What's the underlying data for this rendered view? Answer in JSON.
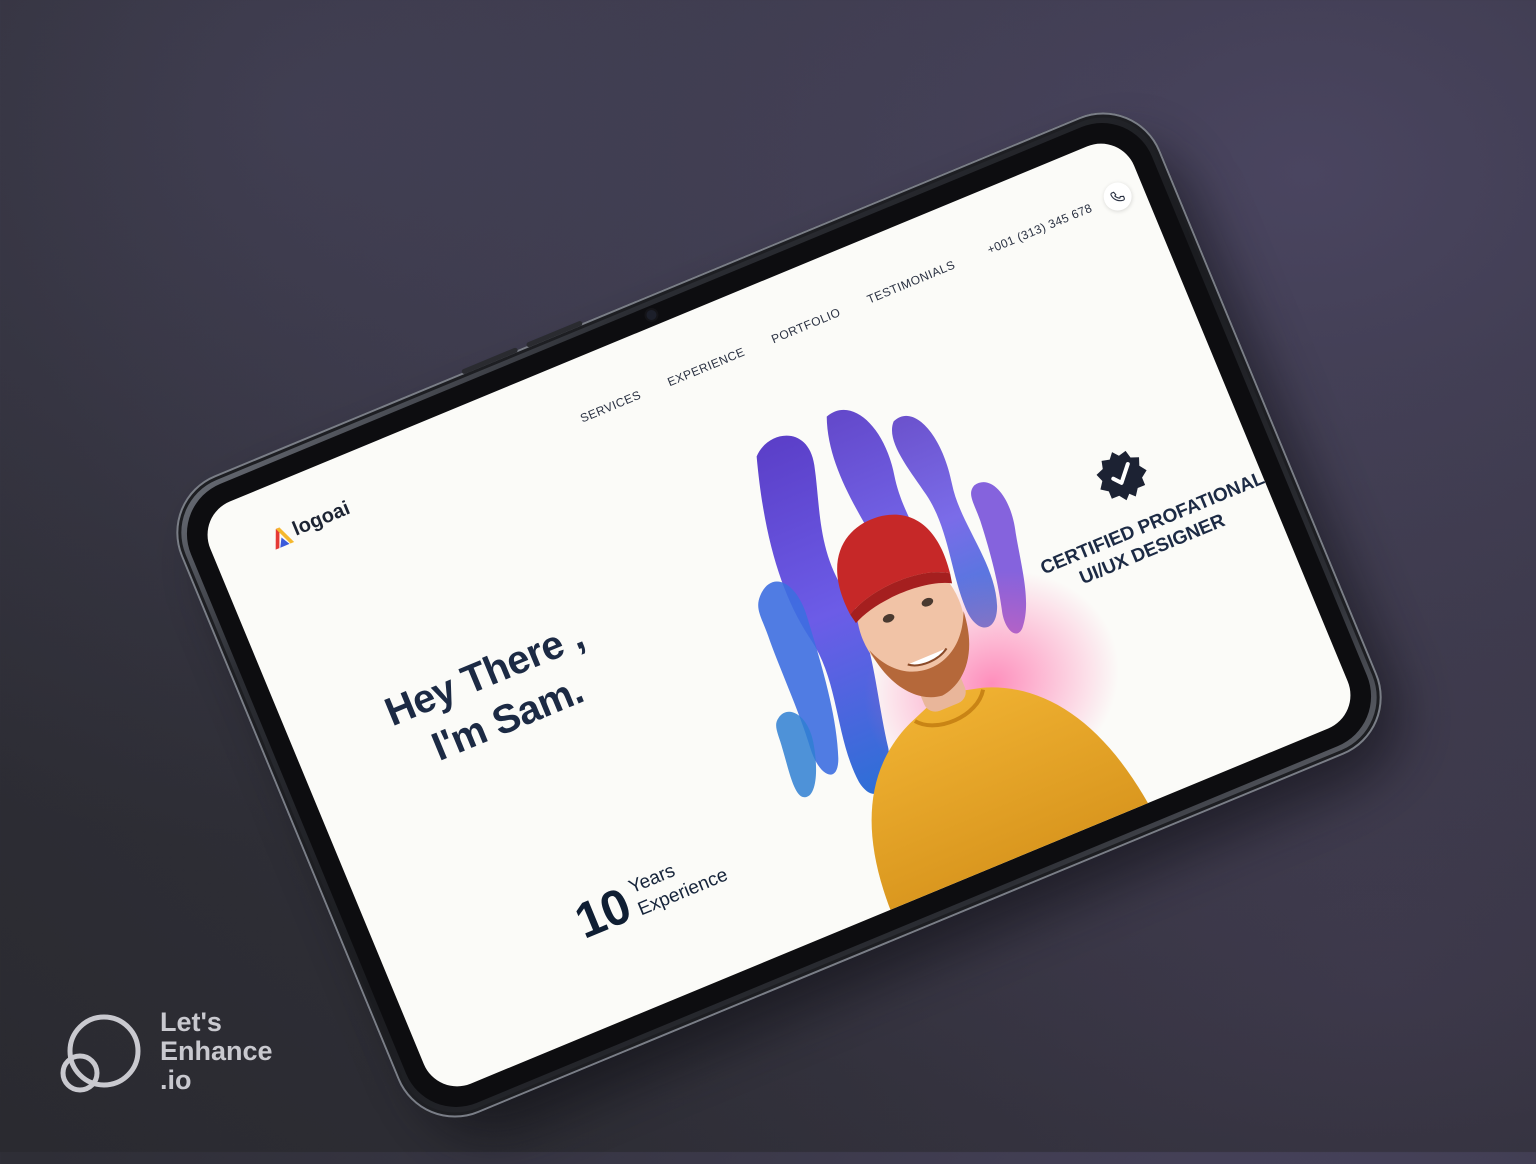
{
  "site": {
    "logo_text": "logoai",
    "nav": [
      {
        "label": "SERVICES"
      },
      {
        "label": "EXPERIENCE"
      },
      {
        "label": "PORTFOLIO"
      },
      {
        "label": "TESTIMONIALS"
      }
    ],
    "phone": "+001 (313) 345 678"
  },
  "hero": {
    "line1": "Hey There ,",
    "line2": "I'm Sam."
  },
  "experience": {
    "number": "10",
    "label_line1": "Years",
    "label_line2": "Experience"
  },
  "badge": {
    "line1": "CERTIFIED PROFATIONAL",
    "line2": "UI/UX DESIGNER"
  },
  "watermark": {
    "line1": "Let's",
    "line2": "Enhance",
    "line3": ".io"
  },
  "colors": {
    "heading": "#1c2a44",
    "screen_bg": "#fbfbf8",
    "accent_red": "#e53935",
    "accent_yellow": "#f5b82e",
    "accent_blue": "#3b5bdb",
    "brush_purple": "#6a4fd0",
    "sweater": "#e8a82a",
    "beanie": "#c62828"
  }
}
